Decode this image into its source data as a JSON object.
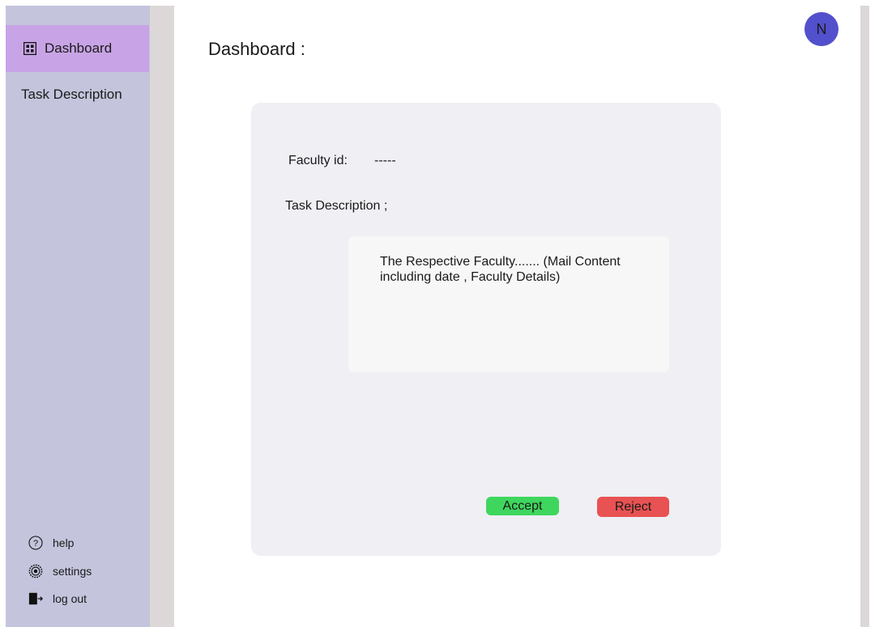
{
  "sidebar": {
    "items": [
      {
        "label": "Dashboard",
        "icon": "grid-icon",
        "active": true
      },
      {
        "label": "Task Description"
      }
    ],
    "bottom": [
      {
        "label": "help",
        "icon": "help-icon"
      },
      {
        "label": "settings",
        "icon": "gear-icon"
      },
      {
        "label": "log out",
        "icon": "logout-icon"
      }
    ]
  },
  "header": {
    "title": "Dashboard :",
    "avatar_initial": "N"
  },
  "card": {
    "faculty_label": "Faculty id:",
    "faculty_value": "-----",
    "task_label": "Task Description ;",
    "mail_content": "The Respective Faculty.......  (Mail Content including date , Faculty Details)",
    "accept_label": "Accept",
    "reject_label": "Reject"
  },
  "colors": {
    "sidebar_bg": "#c4c4dd",
    "active_item": "#c8a4e6",
    "avatar": "#5250cc",
    "accept": "#3fd65e",
    "reject": "#e85252"
  }
}
